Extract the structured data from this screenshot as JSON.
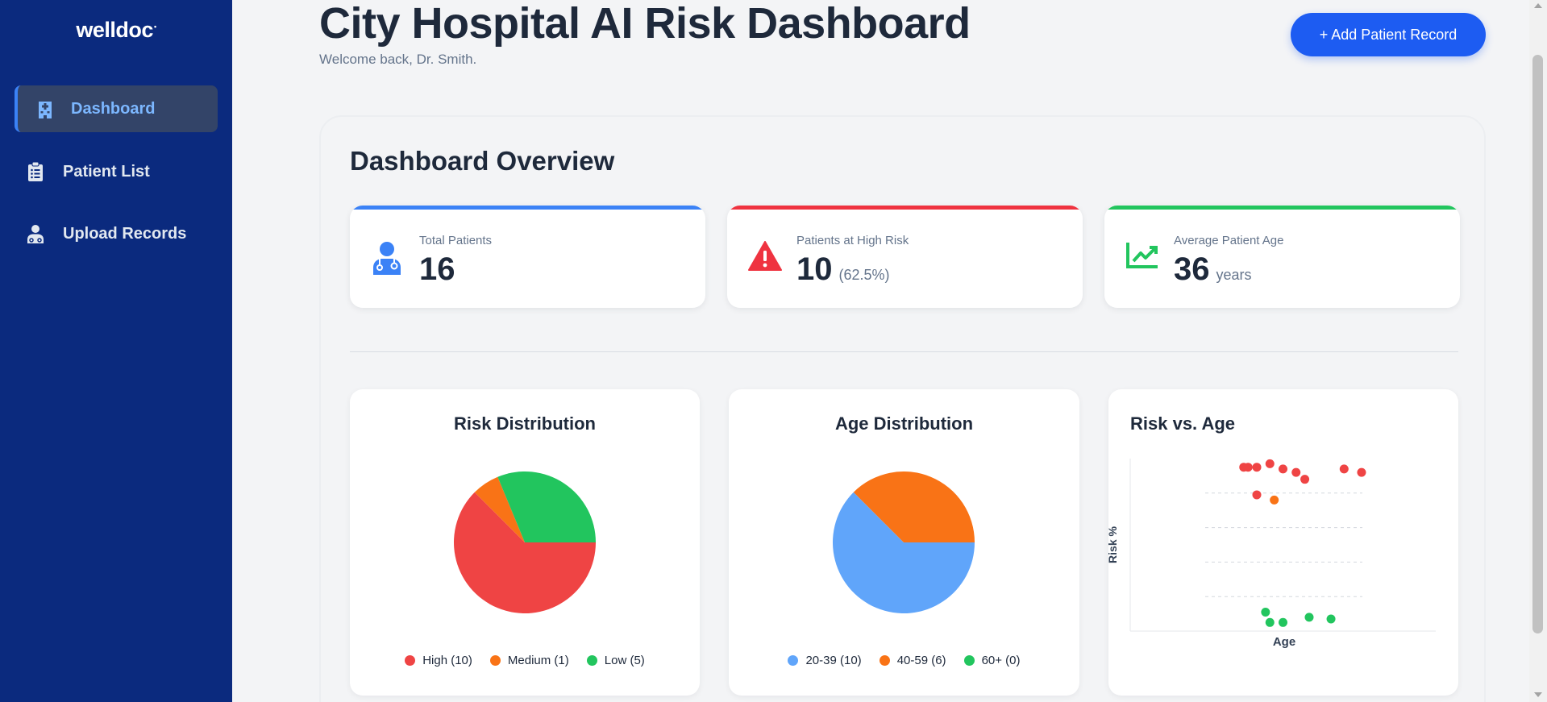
{
  "sidebar": {
    "brand": "welldoc",
    "brand_mark": "•",
    "items": [
      {
        "label": "Dashboard",
        "icon": "hospital-icon",
        "active": true
      },
      {
        "label": "Patient List",
        "icon": "clipboard-list-icon",
        "active": false
      },
      {
        "label": "Upload Records",
        "icon": "user-doctor-icon",
        "active": false
      }
    ]
  },
  "header": {
    "title": "City Hospital AI Risk Dashboard",
    "subtitle": "Welcome back, Dr. Smith.",
    "add_button": "+ Add Patient Record"
  },
  "overview": {
    "title": "Dashboard Overview",
    "stats": [
      {
        "label": "Total Patients",
        "value": "16",
        "sub": "",
        "icon": "user-doctor-icon",
        "color": "#3b82f6"
      },
      {
        "label": "Patients at High Risk",
        "value": "10",
        "sub": "(62.5%)",
        "icon": "warning-triangle-icon",
        "color": "#ef3340"
      },
      {
        "label": "Average Patient Age",
        "value": "36",
        "sub": "years",
        "icon": "trend-up-chart-icon",
        "color": "#22c55e"
      }
    ]
  },
  "colors": {
    "high": "#ef4444",
    "medium": "#f97316",
    "low": "#22c55e",
    "age_20_39": "#60a5fa",
    "age_40_59": "#f97316",
    "age_60_plus": "#22c55e",
    "primary": "#1d5cf2",
    "sidebar": "#0b2a7e"
  },
  "chart_data": [
    {
      "type": "pie",
      "title": "Risk Distribution",
      "labels": [
        "High (10)",
        "Medium (1)",
        "Low (5)"
      ],
      "categories": [
        "High",
        "Medium",
        "Low"
      ],
      "values": [
        10,
        1,
        5
      ],
      "colors": [
        "#ef4444",
        "#f97316",
        "#22c55e"
      ]
    },
    {
      "type": "pie",
      "title": "Age Distribution",
      "labels": [
        "20-39 (10)",
        "40-59 (6)",
        "60+ (0)"
      ],
      "categories": [
        "20-39",
        "40-59",
        "60+"
      ],
      "values": [
        10,
        6,
        0
      ],
      "colors": [
        "#60a5fa",
        "#f97316",
        "#22c55e"
      ]
    },
    {
      "type": "scatter",
      "title": "Risk vs. Age",
      "xlabel": "Age",
      "ylabel": "Risk %",
      "grid": "dashed horizontal",
      "xlim": [
        0,
        70
      ],
      "ylim": [
        0,
        100
      ],
      "points": [
        {
          "x": 26,
          "y": 95,
          "risk": "High"
        },
        {
          "x": 27,
          "y": 95,
          "risk": "High"
        },
        {
          "x": 29,
          "y": 95,
          "risk": "High"
        },
        {
          "x": 32,
          "y": 97,
          "risk": "High"
        },
        {
          "x": 35,
          "y": 94,
          "risk": "High"
        },
        {
          "x": 38,
          "y": 92,
          "risk": "High"
        },
        {
          "x": 40,
          "y": 88,
          "risk": "High"
        },
        {
          "x": 49,
          "y": 94,
          "risk": "High"
        },
        {
          "x": 53,
          "y": 92,
          "risk": "High"
        },
        {
          "x": 29,
          "y": 79,
          "risk": "High"
        },
        {
          "x": 33,
          "y": 76,
          "risk": "Medium"
        },
        {
          "x": 31,
          "y": 11,
          "risk": "Low"
        },
        {
          "x": 32,
          "y": 5,
          "risk": "Low"
        },
        {
          "x": 35,
          "y": 5,
          "risk": "Low"
        },
        {
          "x": 41,
          "y": 8,
          "risk": "Low"
        },
        {
          "x": 46,
          "y": 7,
          "risk": "Low"
        }
      ]
    }
  ]
}
